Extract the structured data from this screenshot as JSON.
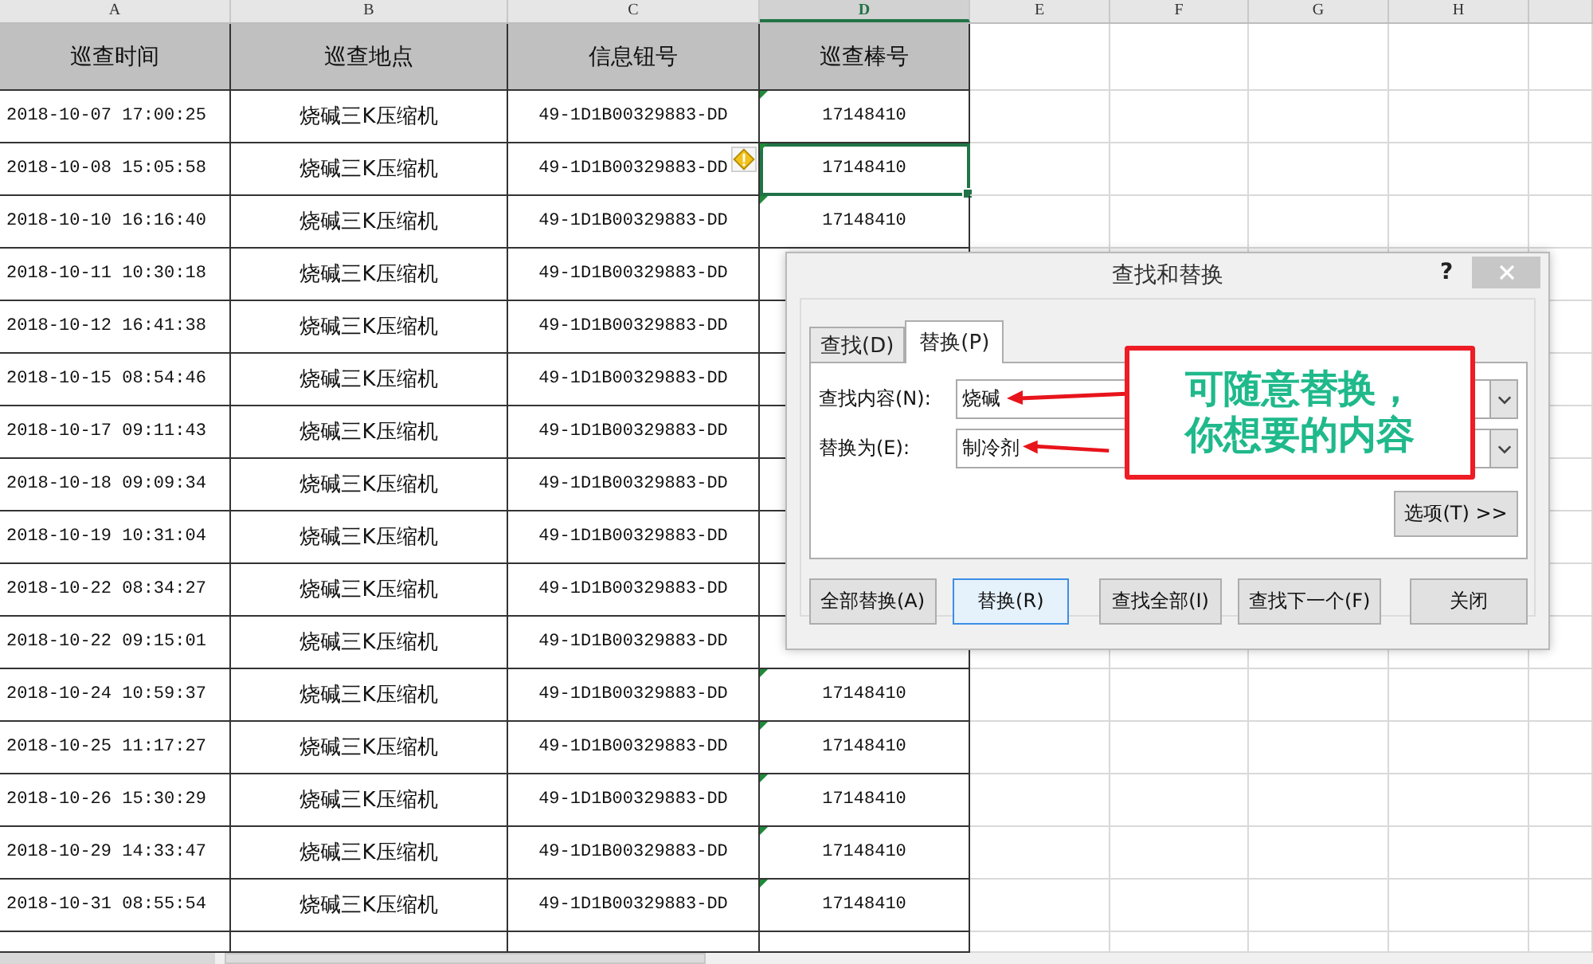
{
  "columns": [
    {
      "letter": "A",
      "selected": false
    },
    {
      "letter": "B",
      "selected": false
    },
    {
      "letter": "C",
      "selected": false
    },
    {
      "letter": "D",
      "selected": true
    },
    {
      "letter": "E",
      "selected": false
    },
    {
      "letter": "F",
      "selected": false
    },
    {
      "letter": "G",
      "selected": false
    },
    {
      "letter": "H",
      "selected": false
    }
  ],
  "header": [
    "巡查时间",
    "巡查地点",
    "信息钮号",
    "巡查棒号"
  ],
  "rows": [
    {
      "time": "2018-10-07 17:00:25",
      "place": "烧碱三K压缩机",
      "button": "49-1D1B00329883-DD",
      "stick": "17148410",
      "selected": false
    },
    {
      "time": "2018-10-08 15:05:58",
      "place": "烧碱三K压缩机",
      "button": "49-1D1B00329883-DD",
      "stick": "17148410",
      "selected": true,
      "warning": true
    },
    {
      "time": "2018-10-10 16:16:40",
      "place": "烧碱三K压缩机",
      "button": "49-1D1B00329883-DD",
      "stick": "17148410",
      "selected": false
    },
    {
      "time": "2018-10-11 10:30:18",
      "place": "烧碱三K压缩机",
      "button": "49-1D1B00329883-DD",
      "selected": false
    },
    {
      "time": "2018-10-12 16:41:38",
      "place": "烧碱三K压缩机",
      "button": "49-1D1B00329883-DD",
      "selected": false
    },
    {
      "time": "2018-10-15 08:54:46",
      "place": "烧碱三K压缩机",
      "button": "49-1D1B00329883-DD",
      "selected": false
    },
    {
      "time": "2018-10-17 09:11:43",
      "place": "烧碱三K压缩机",
      "button": "49-1D1B00329883-DD",
      "selected": false
    },
    {
      "time": "2018-10-18 09:09:34",
      "place": "烧碱三K压缩机",
      "button": "49-1D1B00329883-DD",
      "selected": false
    },
    {
      "time": "2018-10-19 10:31:04",
      "place": "烧碱三K压缩机",
      "button": "49-1D1B00329883-DD",
      "selected": false
    },
    {
      "time": "2018-10-22 08:34:27",
      "place": "烧碱三K压缩机",
      "button": "49-1D1B00329883-DD",
      "selected": false
    },
    {
      "time": "2018-10-22 09:15:01",
      "place": "烧碱三K压缩机",
      "button": "49-1D1B00329883-DD",
      "selected": false
    },
    {
      "time": "2018-10-24 10:59:37",
      "place": "烧碱三K压缩机",
      "button": "49-1D1B00329883-DD",
      "stick": "17148410",
      "selected": false
    },
    {
      "time": "2018-10-25 11:17:27",
      "place": "烧碱三K压缩机",
      "button": "49-1D1B00329883-DD",
      "stick": "17148410",
      "selected": false
    },
    {
      "time": "2018-10-26 15:30:29",
      "place": "烧碱三K压缩机",
      "button": "49-1D1B00329883-DD",
      "stick": "17148410",
      "selected": false
    },
    {
      "time": "2018-10-29 14:33:47",
      "place": "烧碱三K压缩机",
      "button": "49-1D1B00329883-DD",
      "stick": "17148410",
      "selected": false
    },
    {
      "time": "2018-10-31 08:55:54",
      "place": "烧碱三K压缩机",
      "button": "49-1D1B00329883-DD",
      "stick": "17148410",
      "selected": false
    }
  ],
  "dialog": {
    "title": "查找和替换",
    "help": "?",
    "tabs": [
      {
        "label": "查找(D)",
        "selected": false
      },
      {
        "label": "替换(P)",
        "selected": true
      }
    ],
    "fields": [
      {
        "label": "查找内容(N):",
        "value": "烧碱"
      },
      {
        "label": "替换为(E):",
        "value": "制冷剂"
      }
    ],
    "options_button": "选项(T) >>",
    "buttons": [
      {
        "label": "全部替换(A)",
        "default": false
      },
      {
        "label": "替换(R)",
        "default": true
      },
      {
        "label": "查找全部(I)",
        "default": false
      },
      {
        "label": "查找下一个(F)",
        "default": false
      },
      {
        "label": "关闭",
        "default": false
      }
    ]
  },
  "annotation": {
    "text": "可随意替换，你想要的内容"
  }
}
